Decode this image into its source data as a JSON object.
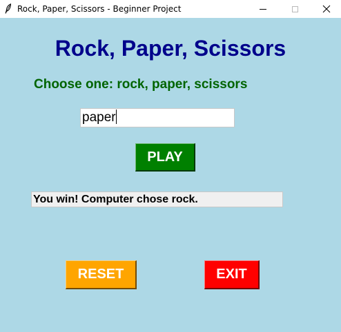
{
  "window": {
    "title": "Rock, Paper, Scissors - Beginner Project",
    "icon": "feather-icon",
    "controls": [
      "minimize-icon",
      "maximize-icon",
      "close-icon"
    ]
  },
  "app": {
    "title": "Rock, Paper, Scissors",
    "instruction": "Choose one: rock, paper, scissors",
    "choice_value": "paper",
    "play_label": "PLAY",
    "result": "You win! Computer chose rock.",
    "reset_label": "RESET",
    "exit_label": "EXIT"
  },
  "colors": {
    "background": "#add8e6",
    "title": "#00008b",
    "instruction": "#006400",
    "play_button": "#008000",
    "reset_button": "#ffa500",
    "exit_button": "#ff0000",
    "result_background": "#f0f0f0"
  }
}
